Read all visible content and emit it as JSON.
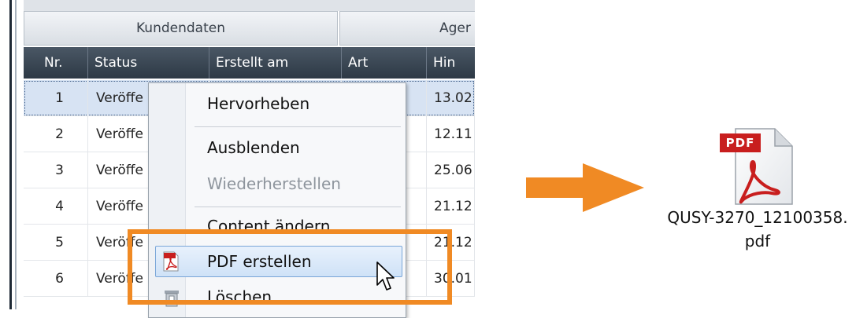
{
  "group_headers": [
    "Kundendaten",
    "Ager"
  ],
  "columns": [
    "Nr.",
    "Status",
    "Erstellt am",
    "Art",
    "Hin"
  ],
  "rows": [
    {
      "nr": "1",
      "status": "Veröffe",
      "hin": "13.02"
    },
    {
      "nr": "2",
      "status": "Veröffe",
      "hin": "12.11"
    },
    {
      "nr": "3",
      "status": "Veröffe",
      "hin": "25.06"
    },
    {
      "nr": "4",
      "status": "Veröffe",
      "hin": "21.12"
    },
    {
      "nr": "5",
      "status": "Veröffe",
      "hin": "21.12"
    },
    {
      "nr": "6",
      "status": "Veröffe",
      "hin": "30.01"
    }
  ],
  "context_menu": {
    "hervorheben": "Hervorheben",
    "ausblenden": "Ausblenden",
    "wiederherstellen": "Wiederherstellen",
    "content_aendern": "Content ändern",
    "pdf_erstellen": "PDF erstellen",
    "loeschen": "Löschen"
  },
  "file": {
    "icon_label": "PDF",
    "name_line1": "QUSY-3270_12100358.",
    "name_line2": "pdf"
  },
  "colors": {
    "accent_orange": "#f08a24",
    "header_dark": "#2d3945",
    "pdf_red": "#c81e1e"
  },
  "icons": [
    "pdf-file-icon",
    "pdf-menu-icon",
    "delete-menu-icon",
    "mouse-cursor-icon",
    "right-arrow-icon"
  ]
}
